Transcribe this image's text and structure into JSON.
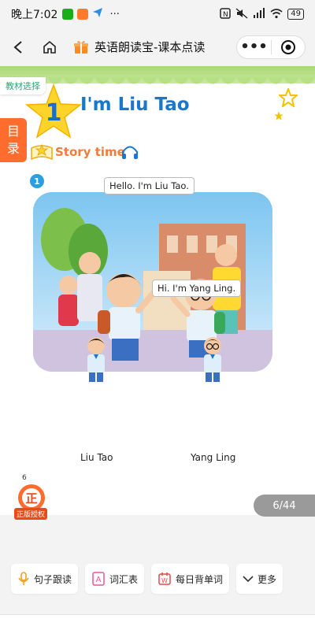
{
  "status": {
    "time": "晚上7:02",
    "more": "···",
    "battery": "49"
  },
  "nav": {
    "title": "英语朗读宝-课本点读",
    "capsule_more": "•••"
  },
  "page": {
    "textbook_select": "教材选择",
    "menu_label_1": "目",
    "menu_label_2": "录",
    "unit_number": "1",
    "unit_title": "I'm Liu Tao",
    "section_label": "Story time",
    "picture_number": "1",
    "bubble_liutao": "Hello. I'm Liu Tao.",
    "bubble_yangling": "Hi. I'm Yang Ling.",
    "name_liutao": "Liu Tao",
    "name_yangling": "Yang Ling",
    "page_number": "6",
    "auth_badge_char": "正",
    "auth_label": "正版授权"
  },
  "pager": {
    "text": "6/44"
  },
  "toolbar": {
    "sentence_follow": "句子跟读",
    "vocabulary": "词汇表",
    "daily_words": "每日背单词",
    "more": "更多"
  },
  "colors": {
    "accent_orange": "#ff6d2e",
    "title_blue": "#1b77c9",
    "leaf_green": "#a8d873"
  }
}
